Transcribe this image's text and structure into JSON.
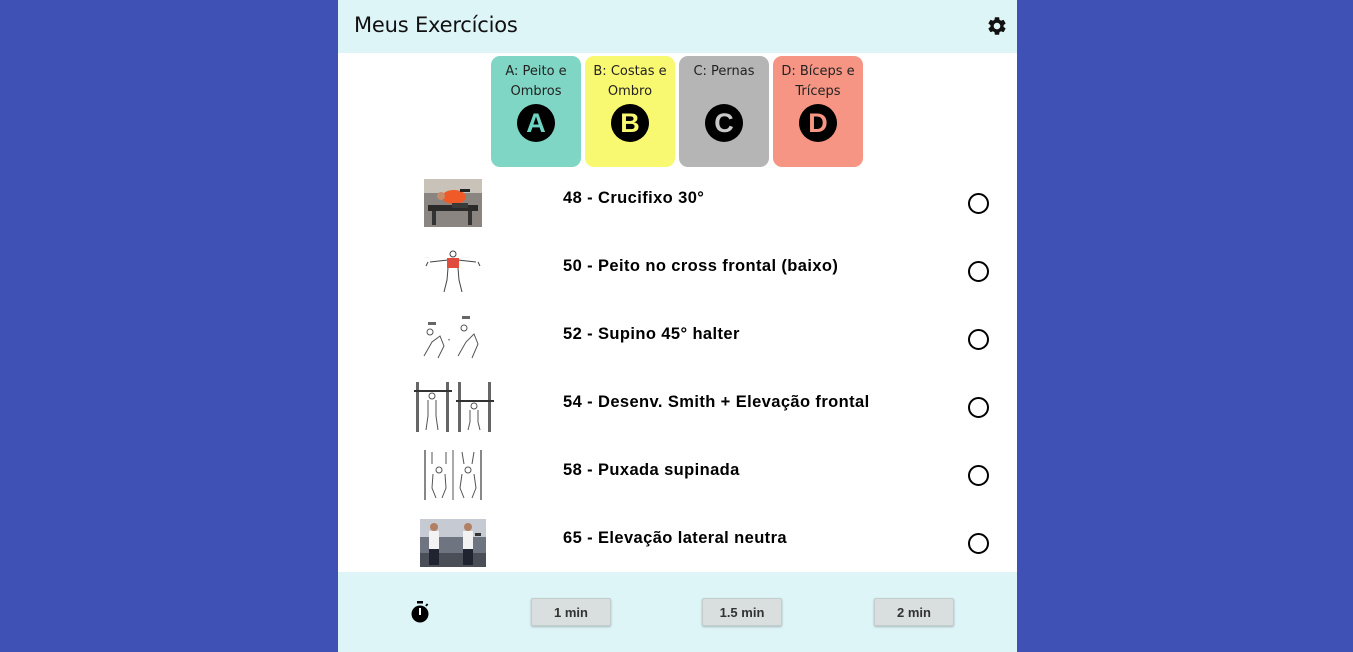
{
  "header": {
    "title": "Meus Exercícios",
    "settings_icon": "gear-icon"
  },
  "workouts": [
    {
      "label": "A: Peito e Ombros",
      "letter": "A",
      "bg": "#80d6c4",
      "letter_color": "#6ed3c1"
    },
    {
      "label": "B: Costas e Ombro",
      "letter": "B",
      "bg": "#f9f871",
      "letter_color": "#f9f871"
    },
    {
      "label": "C: Pernas",
      "letter": "C",
      "bg": "#b5b5b5",
      "letter_color": "#c8c8c8"
    },
    {
      "label": "D: Bíceps e Tríceps",
      "letter": "D",
      "bg": "#f79584",
      "letter_color": "#f79584"
    }
  ],
  "exercises": [
    {
      "name": "48 - Crucifixo 30°",
      "done": false
    },
    {
      "name": "50 - Peito no cross frontal (baixo)",
      "done": false
    },
    {
      "name": "52 - Supino 45° halter",
      "done": false
    },
    {
      "name": "54 - Desenv. Smith + Elevação frontal",
      "done": false
    },
    {
      "name": "58 - Puxada supinada",
      "done": false
    },
    {
      "name": "65 - Elevação lateral neutra",
      "done": false
    }
  ],
  "timer": {
    "icon": "stopwatch-icon",
    "buttons": [
      "1 min",
      "1.5 min",
      "2 min"
    ]
  }
}
